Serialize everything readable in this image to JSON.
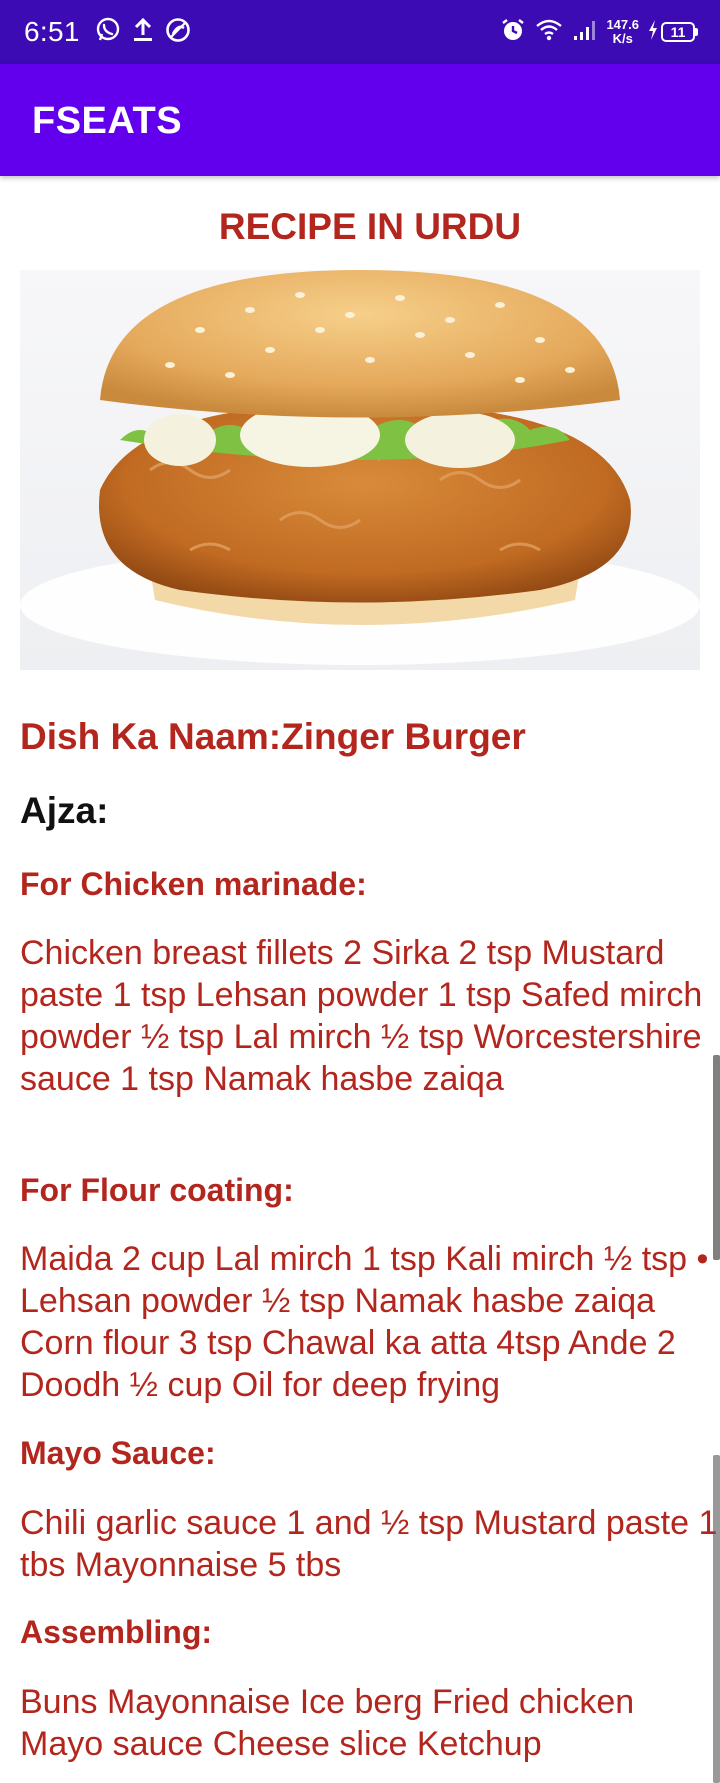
{
  "status_bar": {
    "time": "6:51",
    "icons_left": [
      "whatsapp-icon",
      "upload-icon",
      "sync-icon"
    ],
    "icons_right": [
      "alarm-icon",
      "wifi-icon",
      "signal-icon",
      "charging-icon"
    ],
    "speed_value": "147.6",
    "speed_unit": "K/s",
    "battery": "11"
  },
  "app_bar": {
    "title": "FSEATS"
  },
  "page": {
    "heading": "RECIPE IN URDU",
    "dish_name": "Dish Ka Naam:Zinger Burger",
    "ajza_label": "Ajza:",
    "sections": [
      {
        "title": "For Chicken marinade:",
        "text": "Chicken breast fillets 2  Sirka 2 tsp  Mustard paste 1 tsp  Lehsan powder 1 tsp  Safed mirch powder ½ tsp  Lal mirch ½ tsp  Worcestershire sauce 1 tsp  Namak hasbe zaiqa"
      },
      {
        "title": "For Flour coating:",
        "text": "Maida 2 cup  Lal mirch 1 tsp  Kali mirch ½ tsp • Lehsan powder ½ tsp  Namak hasbe zaiqa  Corn flour 3 tsp  Chawal ka atta 4tsp  Ande 2  Doodh ½ cup  Oil for deep frying"
      },
      {
        "title": "Mayo Sauce:",
        "text": "Chili garlic sauce 1 and ½ tsp  Mustard paste 1 tbs  Mayonnaise 5 tbs"
      },
      {
        "title": "Assembling:",
        "text": "Buns  Mayonnaise  Ice berg  Fried chicken  Mayo sauce  Cheese slice  Ketchup"
      }
    ]
  },
  "colors": {
    "status_bar": "#3d0bb3",
    "app_bar": "#6200ee",
    "accent_text": "#b3261e"
  }
}
